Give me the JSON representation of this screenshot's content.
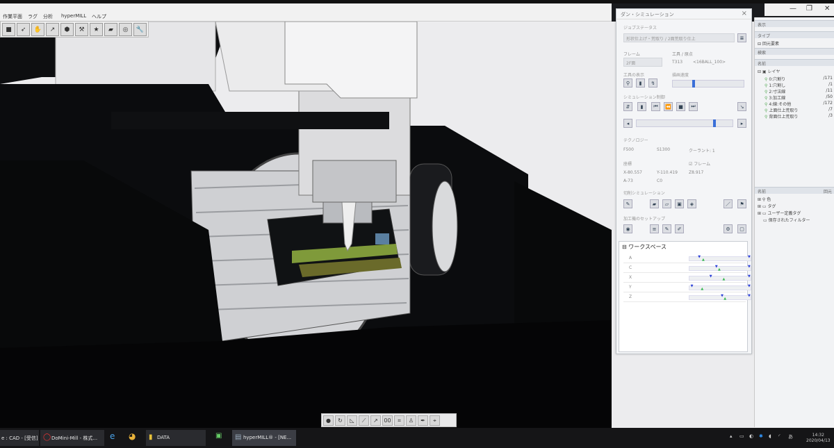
{
  "menu": {
    "items": [
      "作業平面",
      "ラグ",
      "分析",
      "hyperMILL",
      "ヘルプ"
    ]
  },
  "sim_window": {
    "title": "ダン・シミュレーション",
    "job_status_label": "ジョブステータス",
    "job_status_value": "形状仕上げ・荒取り / 2面荒取り仕上",
    "frame_label": "フレーム",
    "frame_value": "2F面",
    "tool_label": "工具 / 原点",
    "tool_number": "T313",
    "tool_name": "<16BALL_100>",
    "tool_display_label": "工具の表示",
    "speed_label": "描画速度",
    "sim_control_label": "シミュレーション制御",
    "technology_label": "テクノロジー",
    "feed": "F500",
    "spindle": "S1300",
    "coolant": "クーラント: 1",
    "coords_label": "座標",
    "frame_check_label": "フレーム",
    "x_coord": "X-80.557",
    "y_coord": "Y-110.419",
    "z_coord": "Z8.917",
    "a_coord": "A-73",
    "c_coord": "C0",
    "cutting_sim_label": "切削シミュレーション",
    "setup_label": "加工機のセットアップ",
    "workspace_label": "ワークスペース",
    "axes": [
      {
        "name": "A",
        "pos": 0.15,
        "green": 0.22
      },
      {
        "name": "C",
        "pos": 0.45,
        "green": 0.5
      },
      {
        "name": "X",
        "pos": 0.35,
        "green": 0.58
      },
      {
        "name": "Y",
        "pos": 0.02,
        "green": 0.2
      },
      {
        "name": "Z",
        "pos": 0.55,
        "green": 0.6
      }
    ]
  },
  "right_panel": {
    "view_label": "表示",
    "type_label": "タイプ",
    "sketch": "回元要素",
    "search_label": "検索",
    "name_label": "名前",
    "layer_label": "レイヤ",
    "layers": [
      {
        "name": "0:穴割り",
        "count": "/171"
      },
      {
        "name": "1:穴割し",
        "count": "/1"
      },
      {
        "name": "2:寸法線",
        "count": "/11"
      },
      {
        "name": "3:加工線",
        "count": "/50"
      },
      {
        "name": "4:線:その他",
        "count": "/172"
      },
      {
        "name": "上面仕上荒取り",
        "count": "/7"
      },
      {
        "name": "背面仕上荒取り",
        "count": "/3"
      }
    ],
    "name2_label": "名前",
    "color_label": "回元",
    "tag_items": [
      "色",
      "タグ",
      "ユーザー定義タグ",
      "保存されたフィルター"
    ]
  },
  "taskbar": {
    "tasks": [
      "e : CAD - [受信]",
      "DoMini-Mill - 株式...",
      "DATA",
      "hyperMILL® - [NE..."
    ],
    "time": "14:32",
    "date": "2020/04/13"
  }
}
